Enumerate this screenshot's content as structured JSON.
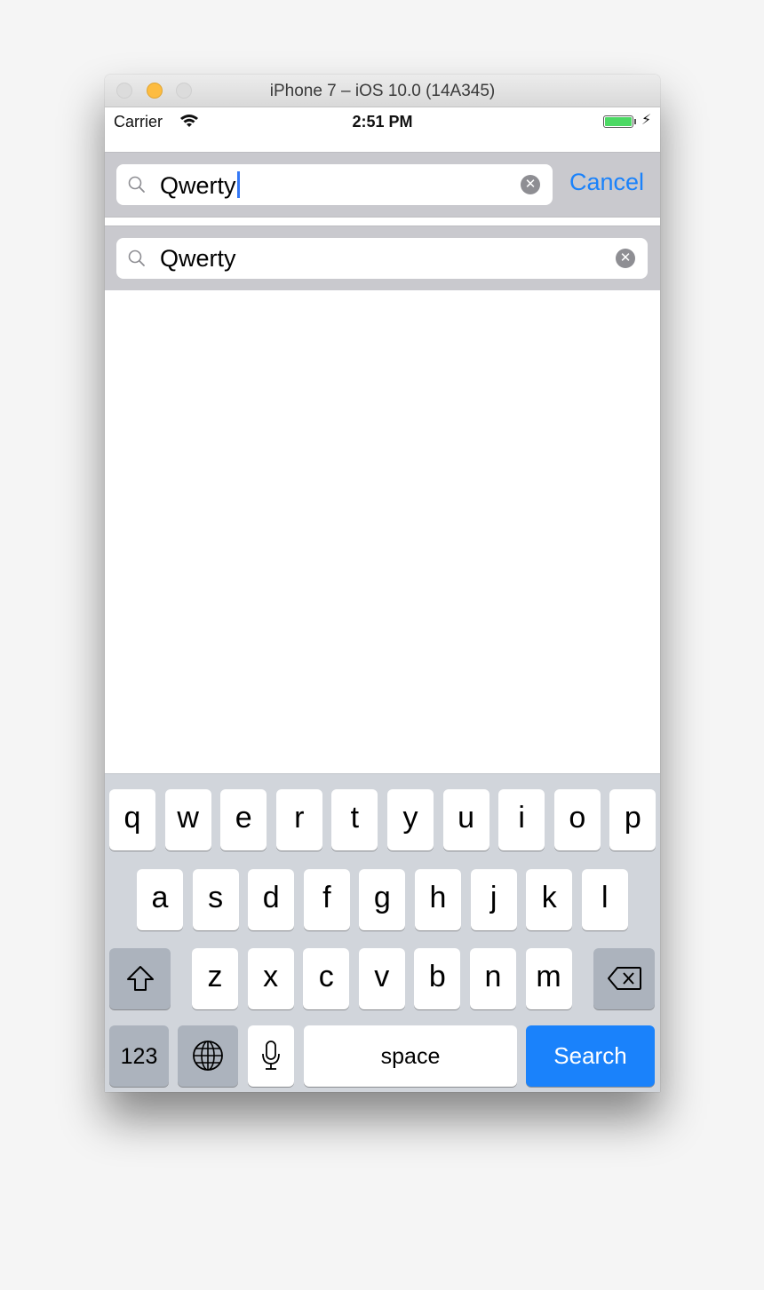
{
  "window": {
    "title": "iPhone 7 – iOS 10.0 (14A345)",
    "traffic_lights": [
      "close",
      "minimize",
      "zoom"
    ]
  },
  "status_bar": {
    "carrier": "Carrier",
    "signal_icon": "wifi-icon",
    "time": "2:51 PM",
    "battery_level": 1.0,
    "battery_color": "#4cd964",
    "charging_icon": "bolt-icon"
  },
  "search_bar_active": {
    "icon": "search-icon",
    "value": "Qwerty",
    "focused": true,
    "clear_icon": "clear-icon",
    "cancel_label": "Cancel"
  },
  "search_bar_secondary": {
    "icon": "search-icon",
    "value": "Qwerty",
    "clear_icon": "clear-icon"
  },
  "keyboard": {
    "row1": [
      "q",
      "w",
      "e",
      "r",
      "t",
      "y",
      "u",
      "i",
      "o",
      "p"
    ],
    "row2": [
      "a",
      "s",
      "d",
      "f",
      "g",
      "h",
      "j",
      "k",
      "l"
    ],
    "row3": [
      "z",
      "x",
      "c",
      "v",
      "b",
      "n",
      "m"
    ],
    "shift_icon": "shift-icon",
    "delete_icon": "delete-icon",
    "numbers_label": "123",
    "globe_icon": "globe-icon",
    "mic_icon": "microphone-icon",
    "space_label": "space",
    "return_label": "Search"
  },
  "colors": {
    "accent": "#1a82fb",
    "caret": "#3478f6",
    "keyboard_bg": "#d1d5db",
    "searchbar_bg": "#c9c9ce"
  }
}
